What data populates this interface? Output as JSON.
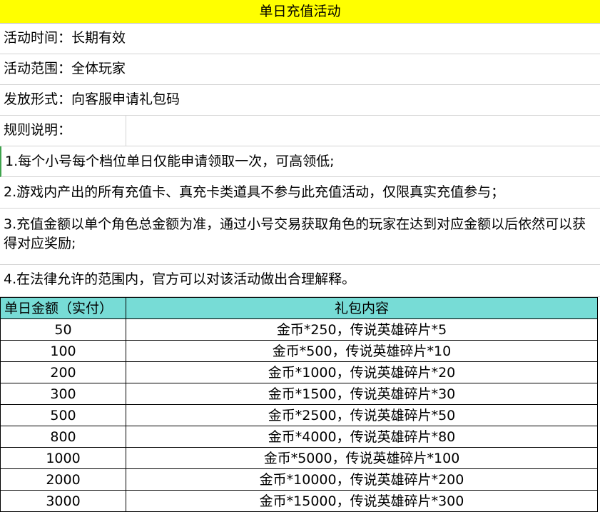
{
  "title": "单日充值活动",
  "info": {
    "time": "活动时间：长期有效",
    "scope": "活动范围：全体玩家",
    "form": "发放形式：向客服申请礼包码",
    "rules_label": "规则说明：",
    "rules": [
      "1.每个小号每个档位单日仅能申请领取一次，可高领低;",
      "2.游戏内产出的所有充值卡、真充卡类道具不参与此充值活动，仅限真实充值参与；",
      "3.充值金额以单个角色总金额为准，通过小号交易获取角色的玩家在达到对应金额以后依然可以获得对应奖励;",
      "4.在法律允许的范围内，官方可以对该活动做出合理解释。"
    ]
  },
  "table": {
    "headers": [
      "单日金额（实付）",
      "礼包内容"
    ],
    "rows": [
      [
        "50",
        "金币*250，传说英雄碎片*5"
      ],
      [
        "100",
        "金币*500，传说英雄碎片*10"
      ],
      [
        "200",
        "金币*1000，传说英雄碎片*20"
      ],
      [
        "300",
        "金币*1500，传说英雄碎片*30"
      ],
      [
        "500",
        "金币*2500，传说英雄碎片*50"
      ],
      [
        "800",
        "金币*4000，传说英雄碎片*80"
      ],
      [
        "1000",
        "金币*5000，传说英雄碎片*100"
      ],
      [
        "2000",
        "金币*10000，传说英雄碎片*200"
      ],
      [
        "3000",
        "金币*15000，传说英雄碎片*300"
      ]
    ]
  },
  "colors": {
    "title_bg": "#ffff00",
    "header_bg": "#77dcd6",
    "selection_marker": "#3fa34d"
  }
}
